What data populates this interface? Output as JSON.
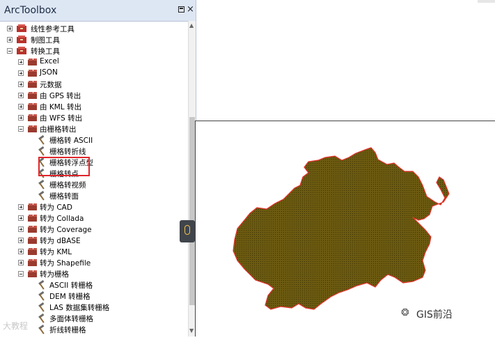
{
  "toolbox": {
    "title": "ArcToolbox",
    "pin_label": "",
    "close_label": "×",
    "items": [
      {
        "label": "线性参考工具"
      },
      {
        "label": "制图工具"
      },
      {
        "label": "转换工具"
      },
      {
        "label": "Excel"
      },
      {
        "label": "JSON"
      },
      {
        "label": "元数据"
      },
      {
        "label": "由 GPS 转出"
      },
      {
        "label": "由 KML 转出"
      },
      {
        "label": "由 WFS 转出"
      },
      {
        "label": "由栅格转出"
      },
      {
        "label": "栅格转 ASCII"
      },
      {
        "label": "栅格转折线"
      },
      {
        "label": "栅格转浮点型"
      },
      {
        "label": "栅格转点"
      },
      {
        "label": "栅格转视频"
      },
      {
        "label": "栅格转面"
      },
      {
        "label": "转为 CAD"
      },
      {
        "label": "转为 Collada"
      },
      {
        "label": "转为 Coverage"
      },
      {
        "label": "转为 dBASE"
      },
      {
        "label": "转为 KML"
      },
      {
        "label": "转为 Shapefile"
      },
      {
        "label": "转为栅格"
      },
      {
        "label": "ASCII 转栅格"
      },
      {
        "label": "DEM 转栅格"
      },
      {
        "label": "LAS 数据集转栅格"
      },
      {
        "label": "多面体转栅格"
      },
      {
        "label": "折线转栅格"
      }
    ]
  },
  "watermark": {
    "text": "GIS前沿",
    "icon": "wechat-icon"
  },
  "corner_watermark": "大教程",
  "colors": {
    "map_fill": "#6b5a10",
    "map_border": "#e8312b",
    "highlight": "#e0262b"
  }
}
